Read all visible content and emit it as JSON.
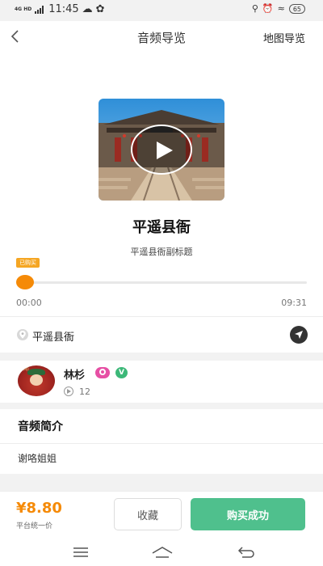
{
  "status_bar": {
    "network": "4G HD",
    "time": "11:45",
    "battery": "65"
  },
  "nav": {
    "title": "音频导览",
    "right_link": "地图导览",
    "back_icon": "chevron-left-icon"
  },
  "cover": {
    "alt": "平遥县衙",
    "play_icon": "play-icon"
  },
  "header": {
    "title": "平遥县衙",
    "subtitle": "平遥县衙副标题"
  },
  "player": {
    "badge": "已购买",
    "current_time": "00:00",
    "total_time": "09:31",
    "progress": 0,
    "accent_color": "#f58a07"
  },
  "location": {
    "name": "平遥县衙",
    "pin_icon": "location-pin-icon",
    "navigate_icon": "navigate-arrow-icon"
  },
  "author": {
    "name": "林杉",
    "play_count": "12",
    "badges": [
      "vip-badge-icon",
      "verified-badge-icon"
    ],
    "verified_letter": "V"
  },
  "intro": {
    "heading": "音频简介",
    "text": "谢咯姐姐"
  },
  "bottom_bar": {
    "price": "¥8.80",
    "price_note": "平台统一价",
    "favorite_label": "收藏",
    "buy_label": "购买成功",
    "buy_color": "#4fc08d"
  }
}
